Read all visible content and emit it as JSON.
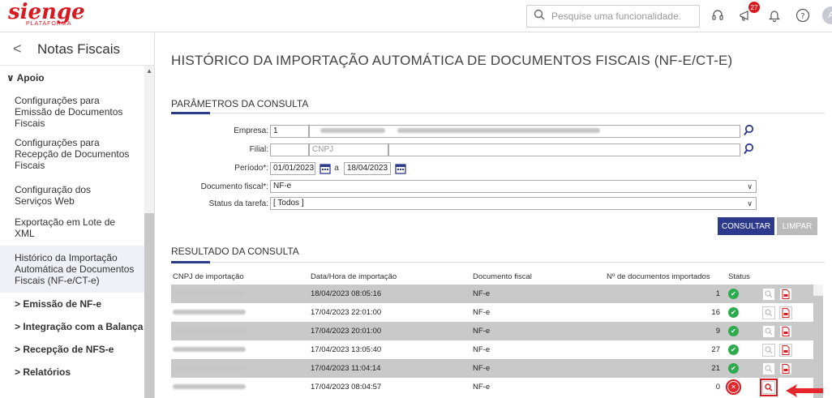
{
  "header": {
    "logo_text": "sienge",
    "logo_subtext": "PLATAFORMA",
    "search_placeholder": "Pesquise uma funcionalidade.",
    "notification_count": "27",
    "avatar_initial": "A"
  },
  "sidebar": {
    "back_label": "<",
    "title": "Notas Fiscais",
    "group": "Apoio",
    "items": [
      {
        "label": "Configurações para Emissão de Documentos Fiscais"
      },
      {
        "label": "Configurações para Recepção de Documentos Fiscais"
      },
      {
        "label": "Configuração dos Serviços Web"
      },
      {
        "label": "Exportação em Lote de XML"
      },
      {
        "label": "Histórico da Importação Automática de Documentos Fiscais (NF-e/CT-e)"
      }
    ],
    "subgroups": [
      {
        "label": "Emissão de NF-e"
      },
      {
        "label": "Integração com a Balança"
      },
      {
        "label": "Recepção de NFS-e"
      },
      {
        "label": "Relatórios"
      }
    ]
  },
  "main": {
    "page_title": "HISTÓRICO DA IMPORTAÇÃO AUTOMÁTICA DE DOCUMENTOS FISCAIS (NF-E/CT-E)",
    "params_title": "PARÂMETROS DA CONSULTA",
    "form": {
      "empresa_label": "Empresa:",
      "empresa_code": "1",
      "filial_label": "Filial:",
      "filial_cnpj_placeholder": "CNPJ",
      "periodo_label": "Período*:",
      "date_from": "01/01/2023",
      "date_sep": "a",
      "date_to": "18/04/2023",
      "documento_label": "Documento fiscal*:",
      "documento_value": "NF-e",
      "status_label": "Status da tarefa:",
      "status_value": "[ Todos ]"
    },
    "buttons": {
      "consultar": "CONSULTAR",
      "limpar": "LIMPAR"
    },
    "results_title": "RESULTADO DA CONSULTA",
    "table": {
      "headers": [
        "CNPJ de importação",
        "Data/Hora de importação",
        "Documento fiscal",
        "Nº de documentos importados",
        "Status"
      ],
      "rows": [
        {
          "datetime": "18/04/2023 08:05:16",
          "doc": "NF-e",
          "count": "1",
          "status": "ok"
        },
        {
          "datetime": "17/04/2023 22:01:00",
          "doc": "NF-e",
          "count": "16",
          "status": "ok"
        },
        {
          "datetime": "17/04/2023 20:01:00",
          "doc": "NF-e",
          "count": "9",
          "status": "ok"
        },
        {
          "datetime": "17/04/2023 13:05:40",
          "doc": "NF-e",
          "count": "27",
          "status": "ok"
        },
        {
          "datetime": "17/04/2023 11:04:14",
          "doc": "NF-e",
          "count": "21",
          "status": "ok"
        },
        {
          "datetime": "17/04/2023 08:04:57",
          "doc": "NF-e",
          "count": "0",
          "status": "error"
        }
      ]
    }
  },
  "colors": {
    "brand": "#d71920",
    "primary_button": "#2d3a8c",
    "ok": "#2eaa4f",
    "error": "#e5262d"
  }
}
